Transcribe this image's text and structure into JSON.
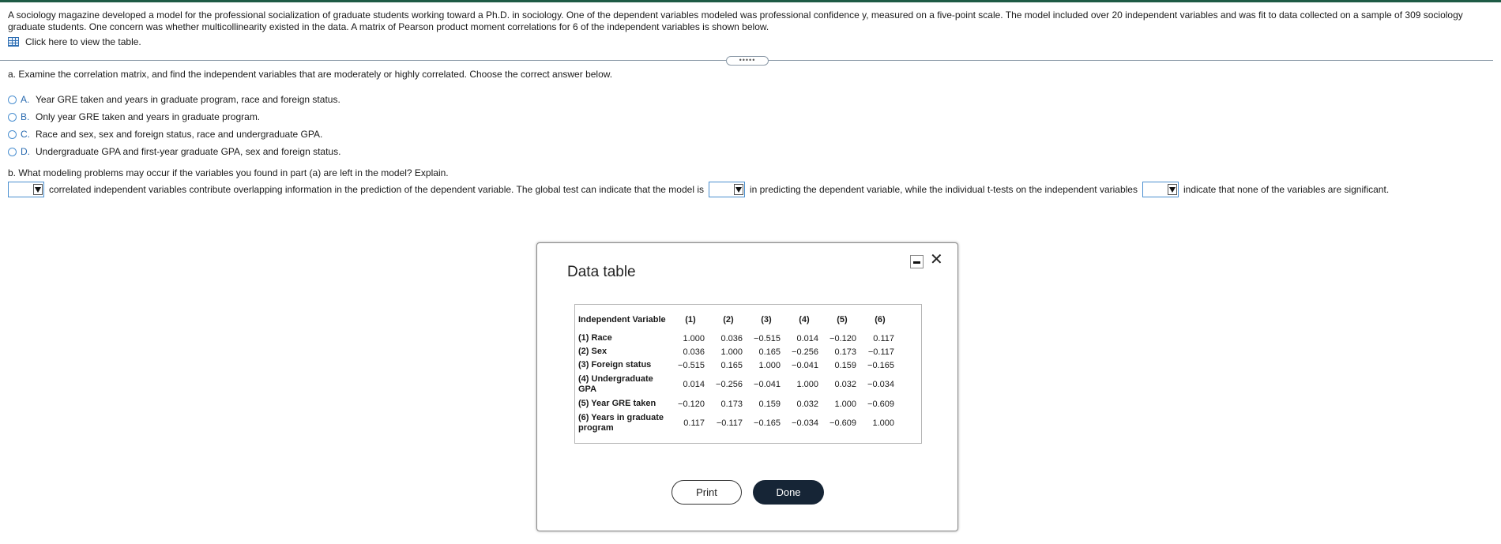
{
  "intro": {
    "text": "A sociology magazine developed a model for the professional socialization of graduate students working toward a Ph.D. in sociology. One of the dependent variables modeled was professional confidence y, measured on a five-point scale. The model included over 20 independent variables and was fit to data collected on a sample of 309 sociology graduate students. One concern was whether multicollinearity existed in the data. A matrix of Pearson product moment correlations for 6 of the independent variables is shown below.",
    "table_link": "Click here to view the table.",
    "table_icon": "table-grid-icon"
  },
  "expand_label": "•••••",
  "part_a": {
    "question": "a. Examine the correlation matrix, and find the independent variables that are moderately or highly correlated. Choose the correct answer below.",
    "options": [
      {
        "letter": "A.",
        "text": "Year GRE taken and years in graduate program, race and foreign status."
      },
      {
        "letter": "B.",
        "text": "Only year GRE taken and years in graduate program."
      },
      {
        "letter": "C.",
        "text": "Race and sex, sex and foreign status, race and undergraduate GPA."
      },
      {
        "letter": "D.",
        "text": "Undergraduate GPA and first-year graduate GPA, sex and foreign status."
      }
    ]
  },
  "part_b": {
    "question": "b. What modeling problems may occur if the variables you found in part (a) are left in the model? Explain.",
    "text1": "correlated independent variables contribute overlapping information in the prediction of the dependent variable. The global test can indicate that the model is",
    "text2": "in predicting the dependent variable, while the individual t-tests on the independent variables",
    "text3": "indicate that none of the variables are significant.",
    "dropdown1_value": "",
    "dropdown2_value": "",
    "dropdown3_value": ""
  },
  "modal": {
    "title": "Data table",
    "header": {
      "label": "Independent Variable",
      "cols": [
        "(1)",
        "(2)",
        "(3)",
        "(4)",
        "(5)",
        "(6)"
      ]
    },
    "rows": [
      {
        "label": "(1) Race",
        "values": [
          "1.000",
          "0.036",
          "−0.515",
          "0.014",
          "−0.120",
          "0.117"
        ]
      },
      {
        "label": "(2) Sex",
        "values": [
          "0.036",
          "1.000",
          "0.165",
          "−0.256",
          "0.173",
          "−0.117"
        ]
      },
      {
        "label": "(3) Foreign status",
        "values": [
          "−0.515",
          "0.165",
          "1.000",
          "−0.041",
          "0.159",
          "−0.165"
        ]
      },
      {
        "label": "(4) Undergraduate GPA",
        "values": [
          "0.014",
          "−0.256",
          "−0.041",
          "1.000",
          "0.032",
          "−0.034"
        ]
      },
      {
        "label": "(5) Year GRE taken",
        "values": [
          "−0.120",
          "0.173",
          "0.159",
          "0.032",
          "1.000",
          "−0.609"
        ]
      },
      {
        "label": "(6) Years in graduate program",
        "values": [
          "0.117",
          "−0.117",
          "−0.165",
          "−0.034",
          "−0.609",
          "1.000"
        ]
      }
    ],
    "print_label": "Print",
    "done_label": "Done"
  }
}
